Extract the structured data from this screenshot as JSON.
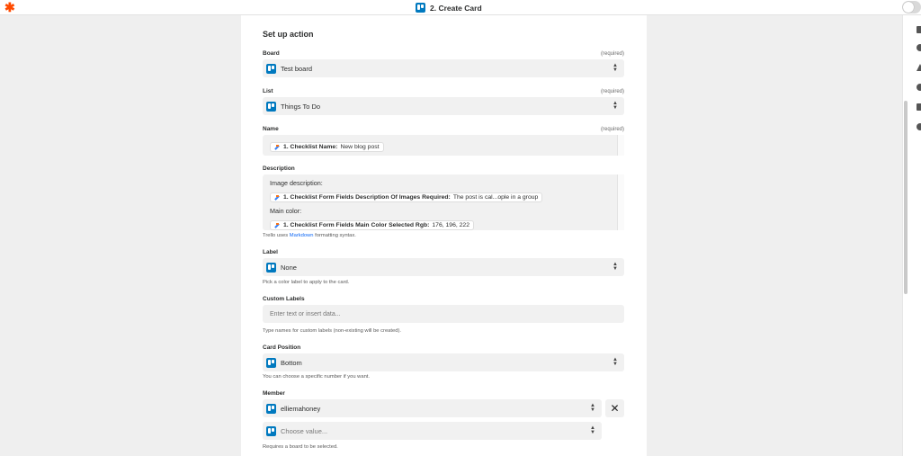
{
  "header": {
    "step_title": "2. Create Card"
  },
  "form": {
    "section_title": "Set up action",
    "required_label": "(required)",
    "board": {
      "label": "Board",
      "value": "Test board"
    },
    "list": {
      "label": "List",
      "value": "Things To Do"
    },
    "name": {
      "label": "Name",
      "pill_key": "1. Checklist Name:",
      "pill_value": "New blog post"
    },
    "description": {
      "label": "Description",
      "line1": "Image description:",
      "pill1_key": "1. Checklist Form Fields Description Of Images Required:",
      "pill1_value": "The post is cal...ople in a group",
      "line2": "Main color:",
      "pill2_key": "1. Checklist Form Fields Main Color Selected Rgb:",
      "pill2_value": "176, 196, 222",
      "hint_prefix": "Trello uses",
      "hint_link": "Markdown",
      "hint_suffix": "formatting syntax."
    },
    "label_field": {
      "label": "Label",
      "value": "None",
      "hint": "Pick a color label to apply to the card."
    },
    "custom_labels": {
      "label": "Custom Labels",
      "placeholder": "Enter text or insert data...",
      "hint": "Type names for custom labels (non-existing will be created)."
    },
    "card_position": {
      "label": "Card Position",
      "value": "Bottom",
      "hint": "You can choose a specific number if you want."
    },
    "member": {
      "label": "Member",
      "value": "elliemahoney",
      "choose_placeholder": "Choose value...",
      "hint": "Requires a board to be selected."
    }
  },
  "colors": {
    "accent": "#ff4a00",
    "trello": "#0079bf",
    "link": "#136bf5"
  }
}
